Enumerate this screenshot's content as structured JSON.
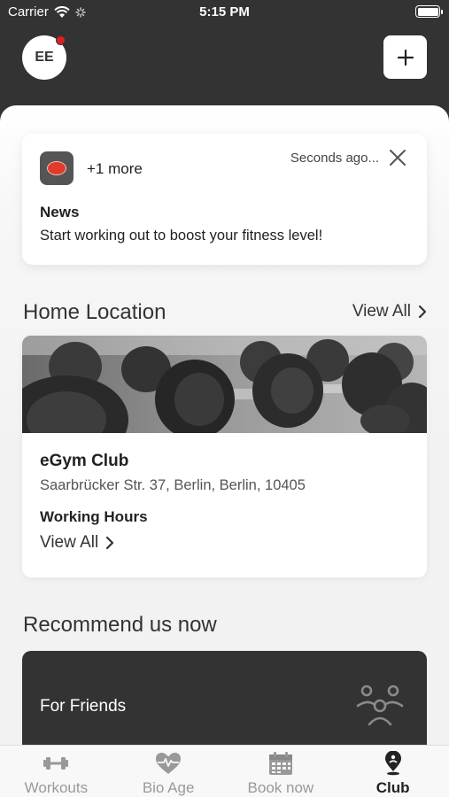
{
  "status_bar": {
    "carrier": "Carrier",
    "time": "5:15 PM"
  },
  "header": {
    "avatar_initials": "EE",
    "add_icon": "plus-icon"
  },
  "notification": {
    "more_text": "+1 more",
    "time": "Seconds ago...",
    "title": "News",
    "body": "Start working out to boost your fitness level!",
    "close_icon": "close-icon"
  },
  "home_location": {
    "title": "Home Location",
    "view_all": "View All",
    "club": {
      "name": "eGym Club",
      "address": "Saarbrücker Str. 37, Berlin, Berlin, 10405",
      "hours_label": "Working Hours",
      "hours_view_all": "View All"
    }
  },
  "recommend": {
    "title": "Recommend us now",
    "card_label": "For Friends",
    "icon": "friends-icon"
  },
  "tab_bar": {
    "tabs": [
      {
        "label": "Workouts",
        "icon": "dumbbell-icon",
        "active": false
      },
      {
        "label": "Bio Age",
        "icon": "heart-pulse-icon",
        "active": false
      },
      {
        "label": "Book now",
        "icon": "calendar-icon",
        "active": false
      },
      {
        "label": "Club",
        "icon": "location-pin-icon",
        "active": true
      }
    ]
  },
  "colors": {
    "header_bg": "#333333",
    "notification_dot": "#e02020",
    "inactive_tab": "#999999",
    "active_tab": "#222222"
  }
}
